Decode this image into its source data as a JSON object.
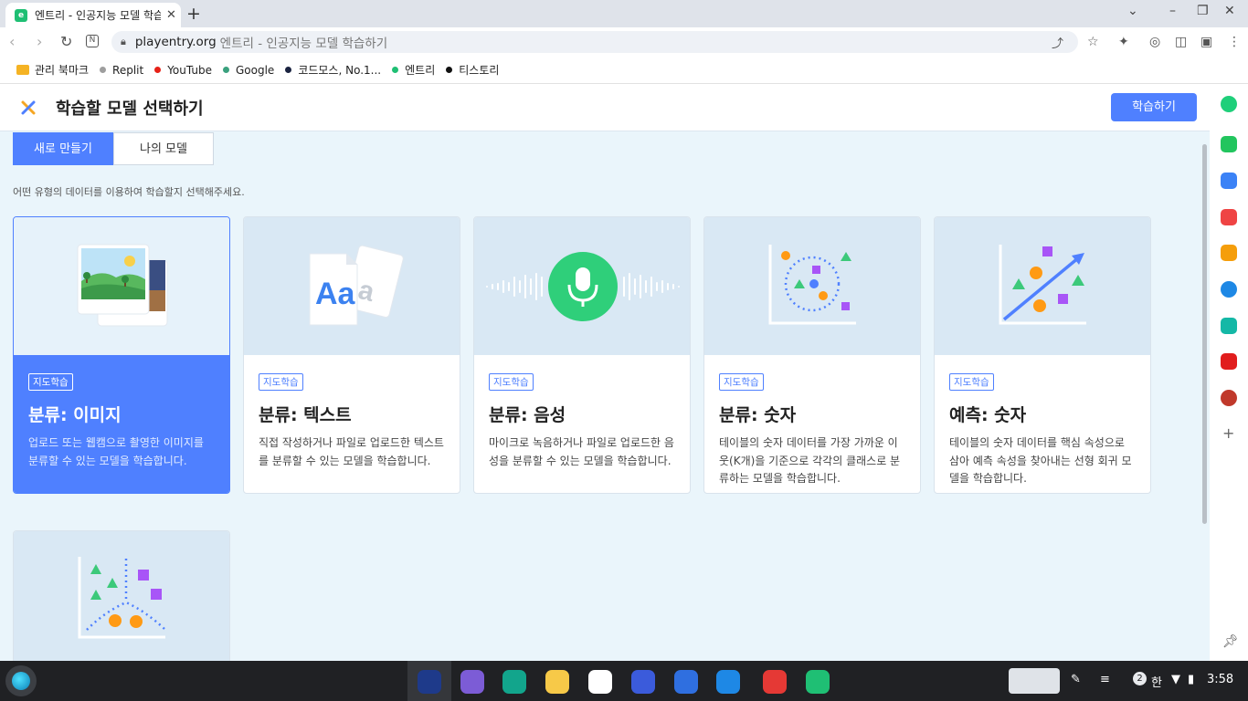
{
  "browser": {
    "tab_title": "엔트리 - 인공지능 모델 학습하",
    "tab_close": "✕",
    "new_tab": "+",
    "url_domain": "playentry.org",
    "url_rest": "엔트리 - 인공지능 모델 학습하기"
  },
  "bookmarks": [
    {
      "label": "관리 북마크",
      "color": "#f5b324",
      "type": "folder"
    },
    {
      "label": "Replit",
      "color": "#9e9e9e"
    },
    {
      "label": "YouTube",
      "color": "#e62117"
    },
    {
      "label": "Google",
      "color": "#3aa17e"
    },
    {
      "label": "코드모스, No.1...",
      "color": "#1a2340"
    },
    {
      "label": "엔트리",
      "color": "#1fbf74"
    },
    {
      "label": "티스토리",
      "color": "#111111"
    }
  ],
  "header": {
    "title": "학습할 모델 선택하기",
    "learn_button": "학습하기"
  },
  "tabs": {
    "new": "새로 만들기",
    "mine": "나의 모델"
  },
  "instruction": "어떤 유형의 데이터를 이용하여 학습할지 선택해주세요.",
  "cards": [
    {
      "tag": "지도학습",
      "title": "분류: 이미지",
      "desc": "업로드 또는 웹캠으로 촬영한 이미지를 분류할 수 있는 모델을 학습합니다."
    },
    {
      "tag": "지도학습",
      "title": "분류: 텍스트",
      "desc": "직접 작성하거나 파일로 업로드한 텍스트를 분류할 수 있는 모델을 학습합니다."
    },
    {
      "tag": "지도학습",
      "title": "분류: 음성",
      "desc": "마이크로 녹음하거나 파일로 업로드한 음성을 분류할 수 있는 모델을 학습합니다."
    },
    {
      "tag": "지도학습",
      "title": "분류: 숫자",
      "desc": "테이블의 숫자 데이터를 가장 가까운 이웃(K개)을 기준으로 각각의 클래스로 분류하는 모델을 학습합니다."
    },
    {
      "tag": "지도학습",
      "title": "예측: 숫자",
      "desc": "테이블의 숫자 데이터를 핵심 속성으로 삼아 예측 속성을 찾아내는 선형 회귀 모델을 학습합니다."
    }
  ],
  "status": {
    "notification_count": "2",
    "ime": "한",
    "time": "3:58"
  }
}
